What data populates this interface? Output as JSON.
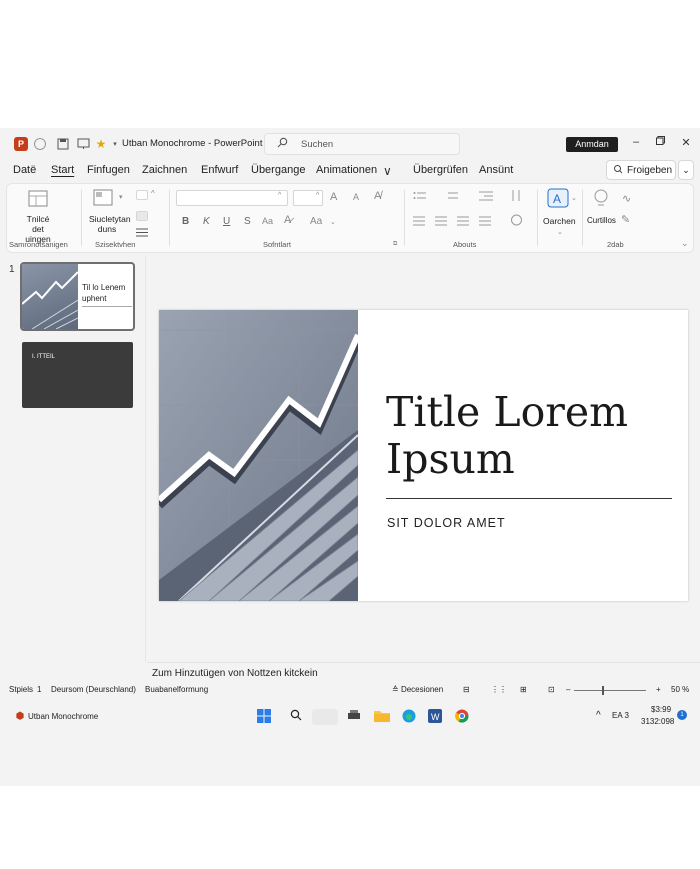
{
  "window": {
    "title": "Utban Monochrome - PowerPoint",
    "search_placeholder": "Suchen",
    "signin_label": "Anmdan",
    "share_label": "Froigeben"
  },
  "tabs": [
    "Datë",
    "Start",
    "Finfugen",
    "Zaichnen",
    "Enfwurf",
    "Übergange",
    "Animationen",
    "Übergrüfen",
    "Ansünt"
  ],
  "ribbon": {
    "new_slide_label": "Tnilcé det uingen",
    "layout_label": "Siucletytan duns",
    "group_clipboard": "Samronotšanigen",
    "group_slides": "Szisektvhen",
    "group_font": "Sofntlart",
    "group_paragraph": "Abouts",
    "group_voice": "2dab",
    "search_label": "Oarchen",
    "designer_label": "Curtillos",
    "bold": "B",
    "italic": "K",
    "underline": "U",
    "strike": "S",
    "font_grow": "A",
    "font_shrink": "A",
    "case_label": "Aa",
    "char_spacing": "Aa"
  },
  "thumbnails": {
    "slide_number": "1",
    "thumb1_title": "Til lo Lenem uphent",
    "thumb2_title": "I. ITTEIL"
  },
  "slide": {
    "title": "Title Lorem Ipsum",
    "subtitle": "SIT DOLOR AMET"
  },
  "notes_placeholder": "Zum Hinzutügen von Nottzen kitckein",
  "status": {
    "slide_label": "Stpiels",
    "slide_value": "1",
    "language": "Deursom (Deurschland)",
    "accessibility": "Buabanelformung",
    "decisions": "Decesionen",
    "zoom": "50 %"
  },
  "taskbar": {
    "app_label": "Utban Monochrome",
    "tray_lang": "EA 3",
    "time": "$3:99",
    "date": "3132:098",
    "notif_count": "1"
  },
  "colors": {
    "ppt_brand": "#c43e1c",
    "accent_blue": "#1f6fd1"
  }
}
